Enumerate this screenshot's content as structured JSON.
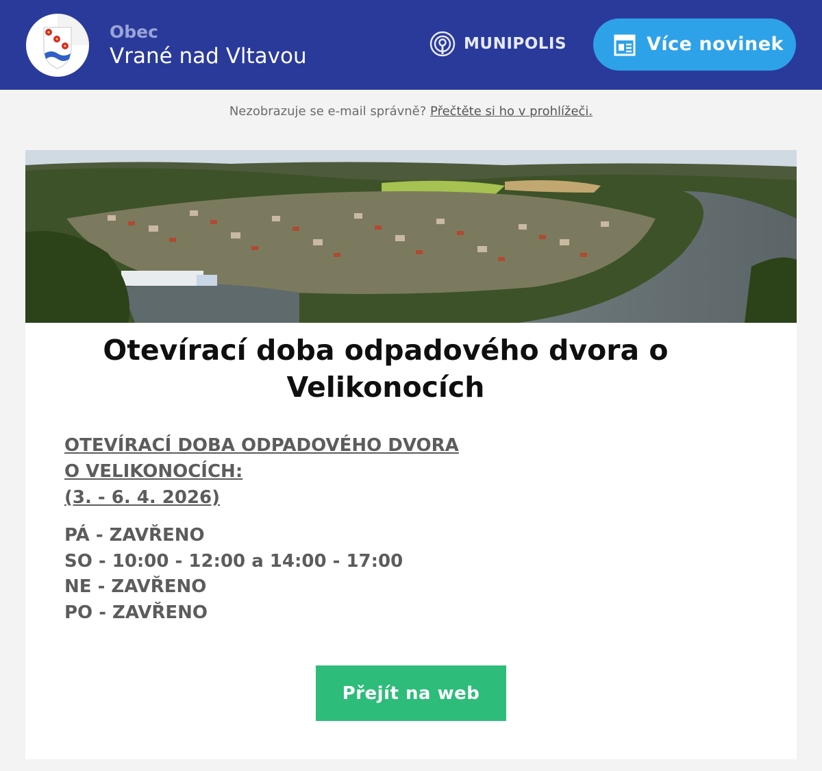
{
  "header": {
    "obec_label": "Obec",
    "town_name": "Vrané nad Vltavou",
    "brand": "MUNIPOLIS",
    "more_news_button": "Více novinek",
    "background_color": "#2a3a9b",
    "button_color": "#2ea2e8"
  },
  "preheader": {
    "text": "Nezobrazuje se e-mail správně?",
    "link": "Přečtěte si ho v prohlížeči."
  },
  "article": {
    "hero_image": "aerial-view-vltava-river-village",
    "title_line1": "Otevírací doba odpadového dvora o",
    "title_line2": "Velikonocích",
    "subheading_line1": "OTEVÍRACÍ DOBA ODPADOVÉHO DVORA",
    "subheading_line2": "O VELIKONOCÍCH:",
    "subheading_line3": "(3. - 6. 4. 2026)",
    "hours": [
      "PÁ - ZAVŘENO",
      "SO - 10:00 - 12:00 a 14:00 - 17:00",
      "NE - ZAVŘENO",
      "PO - ZAVŘENO"
    ],
    "cta_button": "Přejít na web",
    "cta_color": "#2dbc7a"
  }
}
